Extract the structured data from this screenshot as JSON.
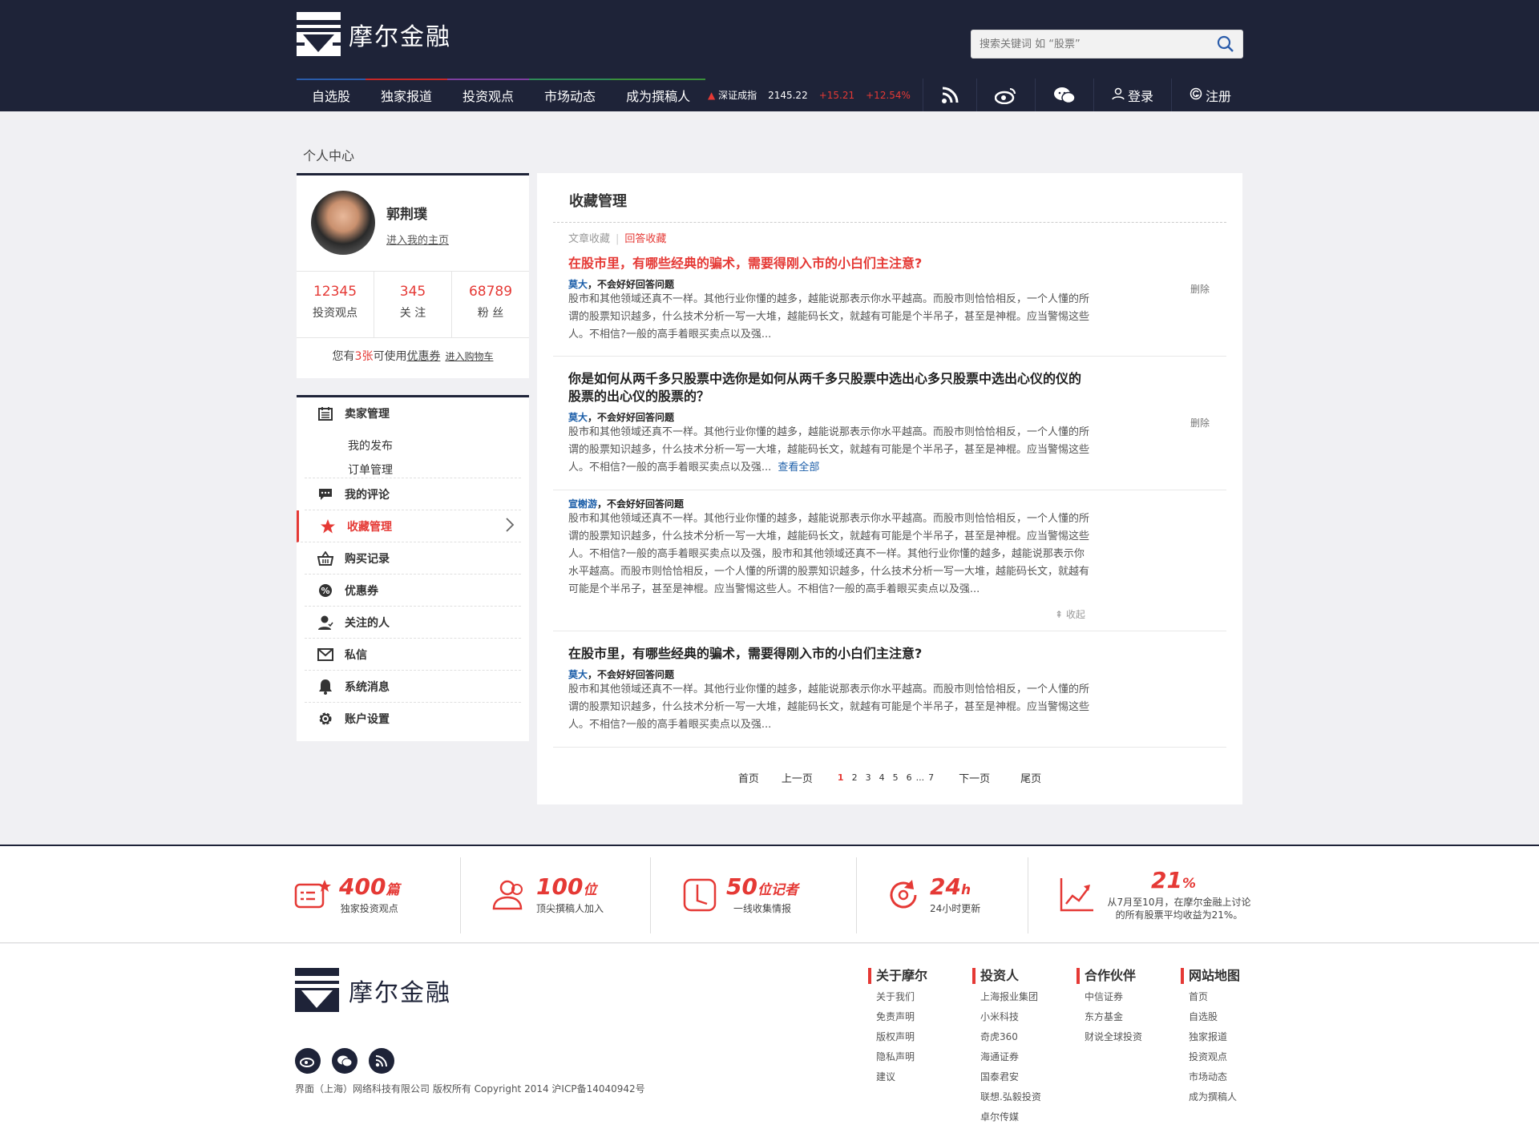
{
  "header": {
    "logo_text": "摩尔金融",
    "search_placeholder": "搜索关键词 如 “股票”",
    "nav": [
      "自选股",
      "独家报道",
      "投资观点",
      "市场动态",
      "成为撰稿人"
    ],
    "ticker": {
      "name": "深证成指",
      "value": "2145.22",
      "change": "+15.21",
      "pct": "+12.54%"
    },
    "login": "登录",
    "register": "注册"
  },
  "breadcrumb": "个人中心",
  "profile": {
    "name": "郭荆璞",
    "home_link": "进入我的主页",
    "stats": [
      {
        "value": "12345",
        "label": "投资观点"
      },
      {
        "value": "345",
        "label": "关 注"
      },
      {
        "value": "68789",
        "label": "粉 丝"
      }
    ],
    "coupon_prefix": "您有",
    "coupon_count": "3张",
    "coupon_mid": "可使用",
    "coupon_link": "优惠券",
    "cart_link": "进入购物车"
  },
  "menu": {
    "seller": "卖家管理",
    "my_posts": "我的发布",
    "orders": "订单管理",
    "comments": "我的评论",
    "favorites": "收藏管理",
    "purchases": "购买记录",
    "coupons": "优惠券",
    "following": "关注的人",
    "messages": "私信",
    "system": "系统消息",
    "settings": "账户设置"
  },
  "main": {
    "title": "收藏管理",
    "tab_articles": "文章收藏",
    "tab_answers": "回答收藏",
    "delete": "删除",
    "view_all": "查看全部",
    "collapse": "收起",
    "items": [
      {
        "title": "在股市里，有哪些经典的骗术，需要得刚入市的小白们主注意?",
        "author": "莫大",
        "tag": "，不会好好回答问题",
        "body": "股市和其他领域还真不一样。其他行业你懂的越多，越能说那表示你水平越高。而股市则恰恰相反，一个人懂的所谓的股票知识越多，什么技术分析一写一大堆，越能码长文，就越有可能是个半吊子，甚至是神棍。应当警惕这些人。不相信?一般的高手着眼买卖点以及强..."
      },
      {
        "title": "你是如何从两千多只股票中选你是如何从两千多只股票中选出心多只股票中选出心仪的仪的股票的出心仪的股票的？",
        "author": "莫大",
        "tag": "，不会好好回答问题",
        "body": "股市和其他领域还真不一样。其他行业你懂的越多，越能说那表示你水平越高。而股市则恰恰相反，一个人懂的所谓的股票知识越多，什么技术分析一写一大堆，越能码长文，就越有可能是个半吊子，甚至是神棍。应当警惕这些人。不相信?一般的高手着眼买卖点以及强..."
      },
      {
        "author": "宣榭游",
        "tag": "，不会好好回答问题",
        "body": "股市和其他领域还真不一样。其他行业你懂的越多，越能说那表示你水平越高。而股市则恰恰相反，一个人懂的所谓的股票知识越多，什么技术分析一写一大堆，越能码长文，就越有可能是个半吊子，甚至是神棍。应当警惕这些人。不相信?一般的高手着眼买卖点以及强，股市和其他领域还真不一样。其他行业你懂的越多，越能说那表示你水平越高。而股市则恰恰相反，一个人懂的所谓的股票知识越多，什么技术分析一写一大堆，越能码长文，就越有可能是个半吊子，甚至是神棍。应当警惕这些人。不相信?一般的高手着眼买卖点以及强..."
      },
      {
        "title": "在股市里，有哪些经典的骗术，需要得刚入市的小白们主注意?",
        "author": "莫大",
        "tag": "，不会好好回答问题",
        "body": "股市和其他领域还真不一样。其他行业你懂的越多，越能说那表示你水平越高。而股市则恰恰相反，一个人懂的所谓的股票知识越多，什么技术分析一写一大堆，越能码长文，就越有可能是个半吊子，甚至是神棍。应当警惕这些人。不相信?一般的高手着眼买卖点以及强..."
      }
    ],
    "pager": {
      "first": "首页",
      "prev": "上一页",
      "pages": [
        "1",
        "2",
        "3",
        "4",
        "5",
        "6",
        "...",
        "7"
      ],
      "current": "1",
      "next": "下一页",
      "last": "尾页"
    }
  },
  "features": [
    {
      "num": "400",
      "unit": "篇",
      "desc": "独家投资观点"
    },
    {
      "num": "100",
      "unit": "位",
      "desc": "顶尖撰稿人加入"
    },
    {
      "num": "50",
      "unit": "位记者",
      "desc": "一线收集情报"
    },
    {
      "num": "24",
      "unit": "h",
      "desc": "24小时更新"
    },
    {
      "num": "21",
      "unit": "%",
      "desc": "从7月至10月，在摩尔金融上讨论的所有股票平均收益为21%。"
    }
  ],
  "footer": {
    "logo_text": "摩尔金融",
    "copyright": "界面（上海）网络科技有限公司 版权所有 Copyright 2014 沪ICP备14040942号",
    "columns": [
      {
        "title": "关于摩尔",
        "links": [
          "关于我们",
          "免责声明",
          "版权声明",
          "隐私声明",
          "建议"
        ]
      },
      {
        "title": "投资人",
        "links": [
          "上海报业集团",
          "小米科技",
          "奇虎360",
          "海通证券",
          "国泰君安",
          "联想.弘毅投资",
          "卓尔传媒"
        ]
      },
      {
        "title": "合作伙伴",
        "links": [
          "中信证券",
          "东方基金",
          "财说全球投资"
        ]
      },
      {
        "title": "网站地图",
        "links": [
          "首页",
          "自选股",
          "独家报道",
          "投资观点",
          "市场动态",
          "成为撰稿人"
        ]
      }
    ]
  },
  "colors": {
    "accent": "#e53935",
    "navy": "#1e2338",
    "link": "#1a5da8"
  }
}
